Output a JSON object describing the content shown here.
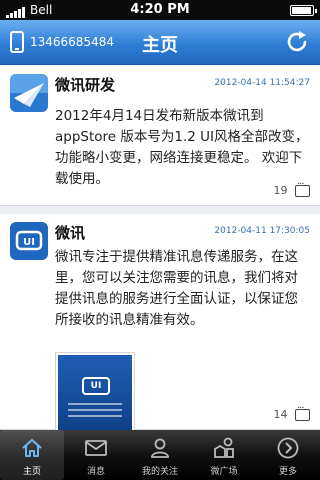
{
  "status_bar": {
    "carrier": "Bell",
    "time": "4:20 PM"
  },
  "header": {
    "phone": "13466685484",
    "title": "主页"
  },
  "feed": [
    {
      "title": "微讯研发",
      "time": "2012-04-14 11:54:27",
      "body": "2012年4月14日发布新版本微讯到appStore 版本号为1.2  UI风格全部改变，功能略小变更，网络连接更稳定。 欢迎下载使用。",
      "comments": "19"
    },
    {
      "title": "微讯",
      "time": "2012-04-11 17:30:05",
      "body": "微讯专注于提供精准讯息传递服务，在这里，您可以关注您需要的讯息，我们将对提供讯息的服务进行全面认证，以保证您所接收的讯息精准有效。",
      "comments": "14",
      "thumb_logo": "UI"
    }
  ],
  "tabs": [
    {
      "label": "主页",
      "icon": "home-icon",
      "active": true
    },
    {
      "label": "消息",
      "icon": "envelope-icon"
    },
    {
      "label": "我的关注",
      "icon": "person-icon"
    },
    {
      "label": "微广场",
      "icon": "plaza-icon"
    },
    {
      "label": "更多",
      "icon": "more-icon"
    }
  ],
  "colors": {
    "header": "#2f7ed6",
    "time_text": "#3b6ea8",
    "tabbar": "#111111"
  }
}
